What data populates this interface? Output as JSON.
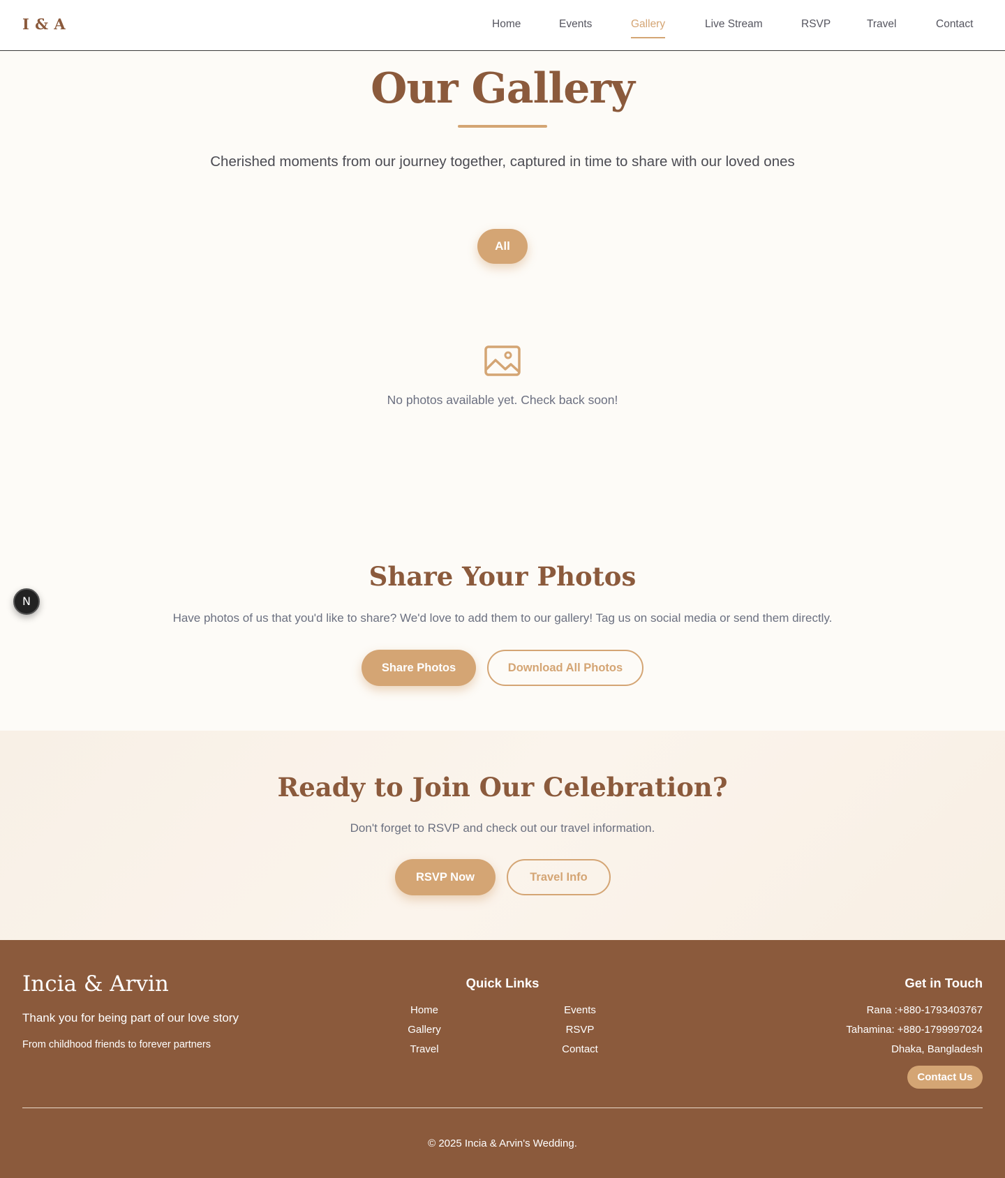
{
  "header": {
    "logo": "I & A",
    "nav": [
      {
        "label": "Home"
      },
      {
        "label": "Events"
      },
      {
        "label": "Gallery",
        "active": true
      },
      {
        "label": "Live Stream"
      },
      {
        "label": "RSVP"
      },
      {
        "label": "Travel"
      },
      {
        "label": "Contact"
      }
    ]
  },
  "hero": {
    "title": "Our Gallery",
    "subtitle": "Cherished moments from our journey together, captured in time to share with our loved ones"
  },
  "filters": {
    "selected": "All"
  },
  "empty_state": {
    "icon": "image-icon",
    "text": "No photos available yet. Check back soon!"
  },
  "share": {
    "title": "Share Your Photos",
    "text": "Have photos of us that you'd like to share? We'd love to add them to our gallery! Tag us on social media or send them directly.",
    "primary_button": "Share Photos",
    "secondary_button": "Download All Photos"
  },
  "floating_badge": {
    "label": "N",
    "icon": "nextjs-icon"
  },
  "cta": {
    "title": "Ready to Join Our Celebration?",
    "text": "Don't forget to RSVP and check out our travel information.",
    "primary_button": "RSVP Now",
    "secondary_button": "Travel Info"
  },
  "footer": {
    "brand": "Incia & Arvin",
    "tagline": "Thank you for being part of our love story",
    "subtagline": "From childhood friends to forever partners",
    "quick_links_title": "Quick Links",
    "quick_links": [
      "Home",
      "Events",
      "Gallery",
      "RSVP",
      "Travel",
      "Contact"
    ],
    "contact_title": "Get in Touch",
    "contact_lines": [
      "Rana :+880-1793403767",
      "Tahamina: +880-1799997024",
      "Dhaka, Bangladesh"
    ],
    "contact_button": "Contact Us",
    "copyright": "© 2025 Incia & Arvin's Wedding."
  },
  "colors": {
    "brand_brown": "#8b5a3c",
    "accent_tan": "#d4a574",
    "page_bg": "#fdfbf7"
  }
}
